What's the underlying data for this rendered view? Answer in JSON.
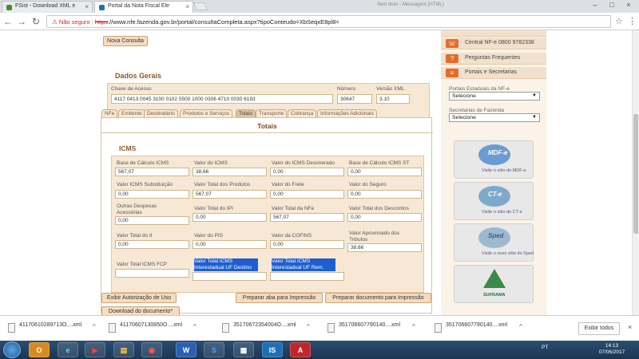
{
  "browser": {
    "tabs": [
      {
        "title": "FSist - Download XML e",
        "active": false
      },
      {
        "title": "Portal da Nota Fiscal Ele",
        "active": true
      },
      {
        "title": "",
        "active": false
      }
    ],
    "address": {
      "security_label": "Não seguro",
      "scheme": "https",
      "url_rest": "://www.nfe.fazenda.gov.br/portal/consultaCompleta.aspx?tipoConteudo=XbSeqxE8pl8="
    },
    "user_tab_hint": "Sem titulo - Mensagem (HTML)"
  },
  "page": {
    "nova_consulta": "Nova Consulta",
    "dados_gerais": {
      "title": "Dados Gerais",
      "chave_label": "Chave de Acesso",
      "chave_value": "4117 0413 0045 3100 0102 5500 1000 0306 4710 0030 6193",
      "numero_label": "Número",
      "numero_value": "30647",
      "versao_label": "Versão XML",
      "versao_value": "3.10"
    },
    "section_tabs": [
      "NFe",
      "Emitente",
      "Destinatário",
      "Produtos e Serviços",
      "Totais",
      "Transporte",
      "Cobrança",
      "Informações Adicionais"
    ],
    "totais_title": "Totais",
    "icms": {
      "title": "ICMS",
      "rows": [
        [
          {
            "label": "Base de Cálculo ICMS",
            "value": "567,07"
          },
          {
            "label": "Valor do ICMS",
            "value": "38,66"
          },
          {
            "label": "Valor do ICMS Desonerado",
            "value": "0,00"
          },
          {
            "label": "Base de Cálculo ICMS ST",
            "value": "0,00"
          }
        ],
        [
          {
            "label": "Valor ICMS Substituição",
            "value": "0,00"
          },
          {
            "label": "Valor Total dos Produtos",
            "value": "567,07"
          },
          {
            "label": "Valor do Frete",
            "value": "0,00"
          },
          {
            "label": "Valor do Seguro",
            "value": "0,00"
          }
        ],
        [
          {
            "label": "Outras Despesas Acessórias",
            "value": "0,00"
          },
          {
            "label": "Valor Total do IPI",
            "value": "0,00"
          },
          {
            "label": "Valor Total da NFe",
            "value": "567,07"
          },
          {
            "label": "Valor Total dos Descontos",
            "value": "0,00"
          }
        ],
        [
          {
            "label": "Valor Total do II",
            "value": "0,00"
          },
          {
            "label": "Valor do PIS",
            "value": "0,00"
          },
          {
            "label": "Valor da COFINS",
            "value": "0,00"
          },
          {
            "label": "Valor Aproximado dos Tributos",
            "value": "38,66"
          }
        ],
        [
          {
            "label": "Valor Total ICMS FCP",
            "value": ""
          },
          {
            "label": "Valor Total ICMS Interestadual UF Destino",
            "value": ""
          },
          {
            "label": "Valor Total ICMS Interestadual UF Rem.",
            "value": ""
          }
        ]
      ]
    },
    "bottom_buttons": {
      "exibir_autorizacao": "Exibir Autorização de Uso",
      "download": "Download do documento*",
      "preparar_aba": "Preparar aba para Impressão",
      "preparar_doc": "Preparar documento para Impressão"
    }
  },
  "sidebar": {
    "central": "Central NF-e 0800 9782338",
    "perguntas": "Perguntas Frequentes",
    "portais": "Portais e Secretarias",
    "portais_estaduais_label": "Portais Estaduais da NF-e",
    "portais_estaduais_value": "Selecione",
    "secretarias_label": "Secretarias de Fazenda",
    "secretarias_value": "Selecione",
    "banners": [
      {
        "text": "Visite o sítio do MDF-e",
        "badge": "MDF-e"
      },
      {
        "text": "Visite o sítio do CT-e",
        "badge": "CT-e"
      },
      {
        "text": "Visite o novo sítio do Sped",
        "badge": "Sped"
      },
      {
        "text": "SUFRAMA",
        "badge": "SUFRAMA"
      }
    ]
  },
  "downloads": {
    "items": [
      "41170610289713O....xml",
      "41170607130850O....xml",
      "35170672354004O....xml",
      "351706607790140....xml",
      "351706607790140....xml"
    ],
    "show_all": "Exibir todos"
  },
  "taskbar": {
    "lang": "PT",
    "time": "14:13",
    "date": "07/06/2017"
  }
}
